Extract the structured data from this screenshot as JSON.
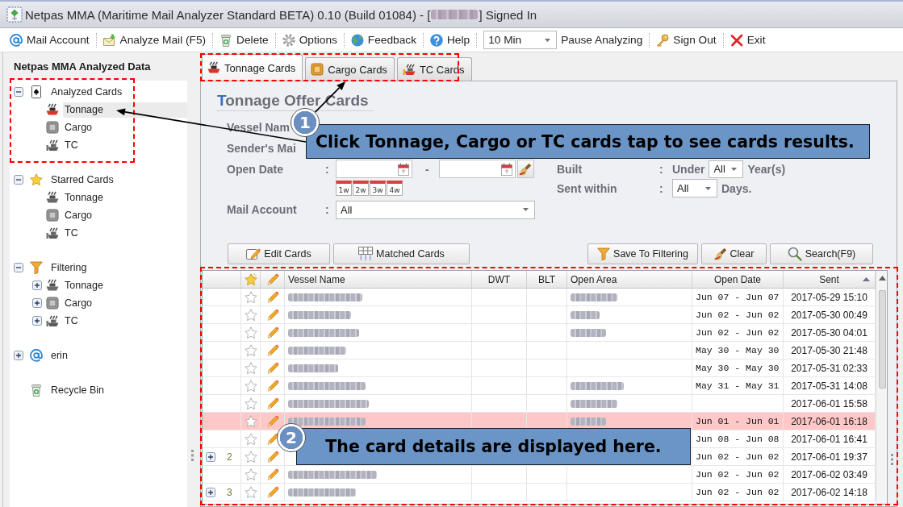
{
  "window": {
    "title": "Netpas MMA (Maritime Mail Analyzer Standard BETA) 0.10 (Build 01084) - [",
    "user_blurred": true,
    "title_end": "] Signed In"
  },
  "toolbar": {
    "groups": [
      [
        {
          "kind": "button",
          "label": "Mail Account"
        }
      ],
      [
        {
          "kind": "button",
          "label": "Analyze Mail (F5)"
        }
      ],
      [
        {
          "kind": "button",
          "label": "Delete"
        }
      ],
      [
        {
          "kind": "button",
          "label": "Options"
        }
      ],
      [
        {
          "kind": "button",
          "label": "Feedback"
        }
      ],
      [
        {
          "kind": "button",
          "label": "Help"
        }
      ],
      [
        {
          "kind": "dropdown",
          "value": "10 Min"
        },
        {
          "kind": "button",
          "label": "Pause Analyzing"
        }
      ],
      [
        {
          "kind": "button",
          "label": "Sign Out"
        }
      ],
      [
        {
          "kind": "button",
          "label": "Exit"
        }
      ]
    ]
  },
  "sidebar": {
    "title": "Netpas MMA Analyzed Data",
    "tree": [
      {
        "kind": "analyzed",
        "label": "Analyzed Cards",
        "expanded": true,
        "selected": false,
        "children": [
          {
            "kind": "tonnage",
            "label": "Tonnage",
            "selected": true
          },
          {
            "kind": "cargo",
            "label": "Cargo",
            "selected": false
          },
          {
            "kind": "tc",
            "label": "TC",
            "selected": false
          }
        ]
      },
      {
        "kind": "starred",
        "label": "Starred Cards",
        "expanded": true,
        "selected": false,
        "children": [
          {
            "kind": "tonnage",
            "label": "Tonnage",
            "selected": false
          },
          {
            "kind": "cargo",
            "label": "Cargo",
            "selected": false
          },
          {
            "kind": "tc",
            "label": "TC",
            "selected": false
          }
        ]
      },
      {
        "kind": "filter",
        "label": "Filtering",
        "expanded": true,
        "selected": false,
        "children": [
          {
            "kind": "tonnage",
            "label": "Tonnage",
            "expanded": false,
            "selected": false
          },
          {
            "kind": "cargo",
            "label": "Cargo",
            "expanded": false,
            "selected": false
          },
          {
            "kind": "tc",
            "label": "TC",
            "expanded": false,
            "selected": false
          }
        ]
      },
      {
        "kind": "account",
        "label": "erin",
        "expanded": false,
        "selected": false
      },
      {
        "kind": "trash",
        "label": "Recycle Bin",
        "selected": false
      }
    ]
  },
  "tabs": [
    {
      "label": "Tonnage Cards",
      "selected": true
    },
    {
      "label": "Cargo Cards",
      "selected": false
    },
    {
      "label": "TC Cards",
      "selected": false
    }
  ],
  "form": {
    "title": "Tonnage Offer Cards",
    "rows": [
      {
        "kind": "covered",
        "label": "Vessel Nam"
      },
      {
        "kind": "covered",
        "label": "Sender's Mai"
      },
      {
        "kind": "date_range",
        "label": "Open Date",
        "colon": ":",
        "dash": "-",
        "quick_ranges": [
          "1w",
          "2w",
          "3w",
          "4w"
        ]
      },
      {
        "kind": "select",
        "label": "Mail Account",
        "colon": ":",
        "value": "All"
      }
    ],
    "side_rows": [
      {
        "kind": "under",
        "label": "Built",
        "colon": ":",
        "prefix": "Under",
        "value": "All",
        "suffix": "Year(s)"
      },
      {
        "kind": "select",
        "label": "Sent within",
        "colon": ":",
        "value": "All",
        "suffix": "Days."
      }
    ]
  },
  "buttons_left": [
    {
      "label": "Edit Cards"
    },
    {
      "label": "Matched Cards"
    }
  ],
  "buttons_right": [
    {
      "label": "Save To Filtering"
    },
    {
      "label": "Clear"
    },
    {
      "label": "Search(F9)"
    }
  ],
  "table": {
    "columns": [
      {
        "kind": "expander"
      },
      {
        "kind": "star"
      },
      {
        "kind": "edit"
      },
      {
        "kind": "text",
        "label": "Vessel Name"
      },
      {
        "kind": "text",
        "label": "DWT"
      },
      {
        "kind": "text",
        "label": "BLT"
      },
      {
        "kind": "text",
        "label": "Open Area"
      },
      {
        "kind": "text",
        "label": "Open Date"
      },
      {
        "kind": "text",
        "label": "Sent",
        "sort_ascending": true
      }
    ],
    "rows": [
      {
        "starred": false,
        "selected": false,
        "vessel_blurred": true,
        "area_blurred": true,
        "open_date": "Jun 07 - Jun 07",
        "sent": "2017-05-29 15:10"
      },
      {
        "starred": false,
        "selected": false,
        "vessel_blurred": true,
        "area_blurred": true,
        "open_date": "Jun 02 - Jun 02",
        "sent": "2017-05-30 00:49"
      },
      {
        "starred": false,
        "selected": false,
        "vessel_blurred": true,
        "area_blurred": true,
        "open_date": "Jun 02 - Jun 02",
        "sent": "2017-05-30 04:01"
      },
      {
        "starred": false,
        "selected": false,
        "vessel_blurred": true,
        "area_blurred": false,
        "open_date": "May 30 - May 30",
        "sent": "2017-05-30 21:48"
      },
      {
        "starred": false,
        "selected": false,
        "vessel_blurred": true,
        "area_blurred": false,
        "open_date": "May 30 - May 30",
        "sent": "2017-05-31 02:33"
      },
      {
        "starred": false,
        "selected": false,
        "vessel_blurred": true,
        "area_blurred": true,
        "open_date": "May 31 - May 31",
        "sent": "2017-05-31 14:08"
      },
      {
        "starred": false,
        "selected": false,
        "vessel_blurred": true,
        "area_blurred": true,
        "sent": "2017-06-01 15:58"
      },
      {
        "starred": false,
        "selected": true,
        "vessel_blurred": true,
        "area_blurred": true,
        "open_date": "Jun 01 - Jun 01",
        "sent": "2017-06-01 16:18"
      },
      {
        "starred": false,
        "selected": false,
        "vessel_blurred": false,
        "area_blurred": false,
        "open_date": "Jun 08 - Jun 08",
        "sent": "2017-06-01 16:41"
      },
      {
        "expanded": false,
        "group": "2",
        "starred": false,
        "selected": false,
        "vessel_blurred": false,
        "area_blurred": false,
        "open_date": "Jun 02 - Jun 02",
        "sent": "2017-06-01 19:37"
      },
      {
        "starred": false,
        "selected": false,
        "vessel_blurred": true,
        "area_blurred": false,
        "open_date": "Jun 02 - Jun 02",
        "sent": "2017-06-02 03:49"
      },
      {
        "expanded": false,
        "group": "3",
        "starred": false,
        "selected": false,
        "vessel_blurred": true,
        "area_blurred": false,
        "open_date": "Jun 02 - Jun 02",
        "sent": "2017-06-02 14:18"
      }
    ]
  },
  "annotations": [
    {
      "number": "1",
      "text": "Click Tonnage, Cargo or TC cards tap to see cards results."
    },
    {
      "number": "2",
      "text": "The card details are displayed here."
    }
  ]
}
